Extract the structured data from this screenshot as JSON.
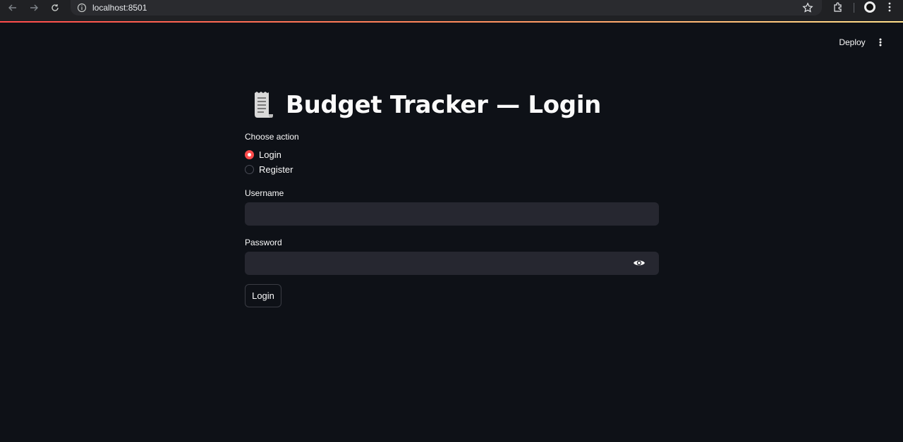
{
  "browser": {
    "url": "localhost:8501"
  },
  "header": {
    "deploy_label": "Deploy"
  },
  "main": {
    "title_icon": "receipt-icon",
    "title": "Budget Tracker — Login",
    "action_label": "Choose action",
    "actions": [
      {
        "label": "Login",
        "selected": true
      },
      {
        "label": "Register",
        "selected": false
      }
    ],
    "username_label": "Username",
    "username_value": "",
    "password_label": "Password",
    "password_value": "",
    "submit_label": "Login"
  },
  "colors": {
    "background": "#0e1117",
    "input_background": "#262730",
    "accent": "#ff4b4b"
  }
}
